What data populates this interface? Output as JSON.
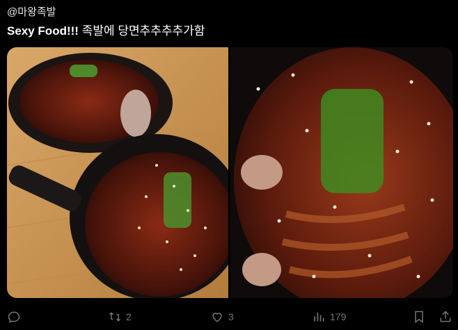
{
  "tweet": {
    "handle": "@마왕족발",
    "text_bold": "Sexy Food!!!",
    "text_rest": " 족발에 당면추추추추가함"
  },
  "media": {
    "images": [
      {
        "alt": "photo-left"
      },
      {
        "alt": "photo-right"
      }
    ]
  },
  "actions": {
    "reply": {
      "icon": "reply-icon",
      "count": ""
    },
    "retweet": {
      "icon": "retweet-icon",
      "count": "2"
    },
    "like": {
      "icon": "heart-icon",
      "count": "3"
    },
    "views": {
      "icon": "views-icon",
      "count": "179"
    },
    "bookmark": {
      "icon": "bookmark-icon"
    },
    "share": {
      "icon": "share-icon"
    }
  },
  "colors": {
    "background": "#000000",
    "text": "#e7e9ea",
    "muted": "#71767b"
  }
}
